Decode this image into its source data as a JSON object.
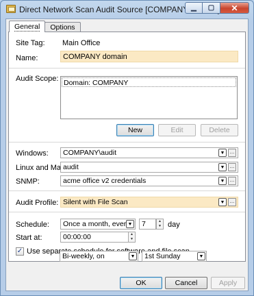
{
  "window": {
    "title": "Direct Network Scan Audit Source [COMPANY domain]",
    "minimize_glyph": "▁",
    "maximize_glyph": "▢",
    "close_glyph": "✕"
  },
  "tabs": [
    {
      "label": "General",
      "active": true
    },
    {
      "label": "Options",
      "active": false
    }
  ],
  "general": {
    "site_tag": {
      "label": "Site Tag:",
      "value": "Main Office"
    },
    "name": {
      "label": "Name:",
      "value": "COMPANY domain"
    },
    "audit_scope": {
      "label": "Audit Scope:",
      "items": [
        "Domain: COMPANY"
      ],
      "buttons": {
        "new": "New",
        "edit": "Edit",
        "delete": "Delete"
      }
    },
    "credentials": {
      "windows": {
        "label": "Windows:",
        "value": "COMPANY\\audit"
      },
      "linux_mac": {
        "label": "Linux and Mac:",
        "value": "audit"
      },
      "snmp": {
        "label": "SNMP:",
        "value": "acme office v2 credentials"
      }
    },
    "audit_profile": {
      "label": "Audit Profile:",
      "value": "Silent with File Scan"
    },
    "schedule": {
      "label": "Schedule:",
      "value": "Once a month, every",
      "day_number": "7",
      "day_unit": "day",
      "start_label": "Start at:",
      "start_value": "00:00:00",
      "separate_checkbox_label": "Use separate schedule for software and file scan",
      "separate_checked": true,
      "separate_frequency": "Bi-weekly, on",
      "separate_day": "1st Sunday"
    }
  },
  "footer": {
    "ok": "OK",
    "cancel": "Cancel",
    "apply": "Apply"
  },
  "icons": {
    "dropdown": "▼",
    "ellipsis": "...",
    "check": "✓",
    "spin_up": "▲",
    "spin_down": "▼"
  }
}
